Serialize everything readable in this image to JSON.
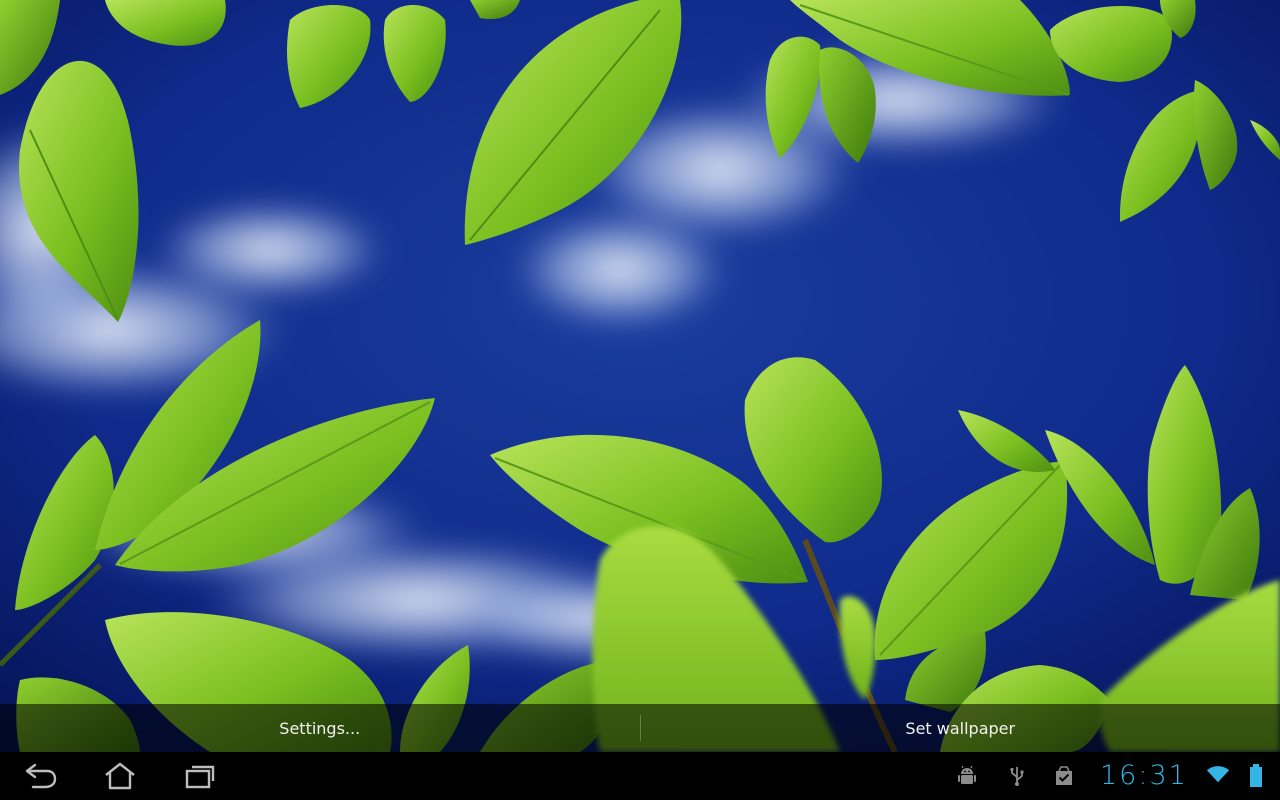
{
  "wallpaper": {
    "sky_colors": [
      "#0a1c6e",
      "#1f4fb8",
      "#d7e3f5"
    ],
    "leaf_colors": [
      "#9ad23a",
      "#6fb21c",
      "#3d7a10"
    ]
  },
  "action_bar": {
    "settings_label": "Settings...",
    "set_wallpaper_label": "Set wallpaper"
  },
  "navigation": {
    "back_icon": "back-icon",
    "home_icon": "home-icon",
    "recents_icon": "recent-apps-icon"
  },
  "status_bar": {
    "time": "16:31",
    "accent_color": "#33b5e5",
    "icons": [
      "android-debug-icon",
      "usb-icon",
      "download-complete-icon",
      "wifi-icon",
      "battery-icon"
    ]
  }
}
